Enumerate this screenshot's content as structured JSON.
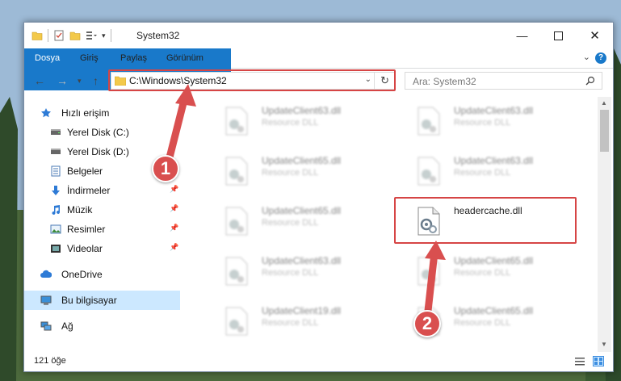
{
  "window": {
    "title": "System32"
  },
  "ribbon": {
    "tabs": [
      "Dosya",
      "Giriş",
      "Paylaş",
      "Görünüm"
    ],
    "help_label": "?"
  },
  "address": {
    "path": "C:\\Windows\\System32",
    "search_placeholder": "Ara: System32"
  },
  "navpane": {
    "items": [
      {
        "label": "Hızlı erişim",
        "icon": "star-icon"
      },
      {
        "label": "Yerel Disk (C:)",
        "icon": "drive-icon"
      },
      {
        "label": "Yerel Disk (D:)",
        "icon": "drive-icon"
      },
      {
        "label": "Belgeler",
        "icon": "document-icon"
      },
      {
        "label": "İndirmeler",
        "icon": "download-icon"
      },
      {
        "label": "Müzik",
        "icon": "music-icon"
      },
      {
        "label": "Resimler",
        "icon": "pictures-icon"
      },
      {
        "label": "Videolar",
        "icon": "video-icon"
      },
      {
        "label": "OneDrive",
        "icon": "cloud-icon"
      },
      {
        "label": "Bu bilgisayar",
        "icon": "computer-icon"
      },
      {
        "label": "Ağ",
        "icon": "network-icon"
      }
    ]
  },
  "files": [
    {
      "name": "UpdateClient63.dll",
      "type": "Resource DLL"
    },
    {
      "name": "UpdateClient63.dll",
      "type": "Resource DLL"
    },
    {
      "name": "UpdateClient65.dll",
      "type": "Resource DLL"
    },
    {
      "name": "UpdateClient63.dll",
      "type": "Resource DLL"
    },
    {
      "name": "UpdateClient65.dll",
      "type": "Resource DLL"
    },
    {
      "name": "headercache.dll",
      "type": ""
    },
    {
      "name": "UpdateClient63.dll",
      "type": "Resource DLL"
    },
    {
      "name": "UpdateClient65.dll",
      "type": "Resource DLL"
    },
    {
      "name": "UpdateClient19.dll",
      "type": "Resource DLL"
    },
    {
      "name": "UpdateClient65.dll",
      "type": "Resource DLL"
    }
  ],
  "status": {
    "count": "121 öğe"
  },
  "annotations": {
    "step1": "1",
    "step2": "2"
  },
  "colors": {
    "accent": "#1979ca",
    "highlight": "#d64545",
    "selected": "#cce8ff"
  }
}
